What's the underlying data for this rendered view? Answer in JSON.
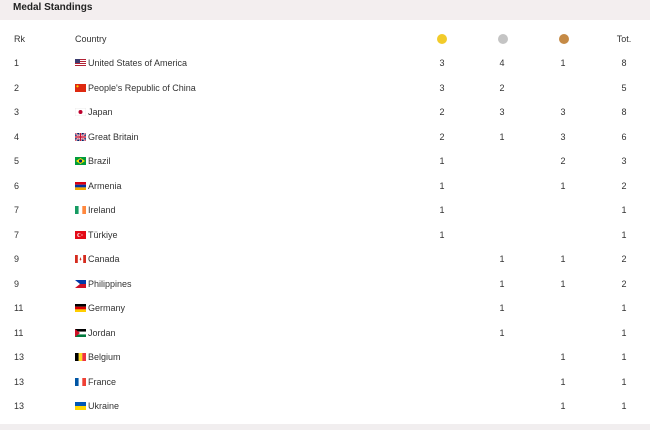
{
  "title": "Medal Standings",
  "headers": {
    "rank": "Rk",
    "country": "Country",
    "total": "Tot."
  },
  "medal_colors": {
    "gold": "#f2cb2a",
    "silver": "#c4c4c4",
    "bronze": "#c58a45"
  },
  "rows": [
    {
      "rank": "1",
      "country": "United States of America",
      "flag": "us-flag-icon",
      "gold": "3",
      "silver": "4",
      "bronze": "1",
      "total": "8"
    },
    {
      "rank": "2",
      "country": "People's Republic of China",
      "flag": "china-flag-icon",
      "gold": "3",
      "silver": "2",
      "bronze": "",
      "total": "5"
    },
    {
      "rank": "3",
      "country": "Japan",
      "flag": "japan-flag-icon",
      "gold": "2",
      "silver": "3",
      "bronze": "3",
      "total": "8"
    },
    {
      "rank": "4",
      "country": "Great Britain",
      "flag": "uk-flag-icon",
      "gold": "2",
      "silver": "1",
      "bronze": "3",
      "total": "6"
    },
    {
      "rank": "5",
      "country": "Brazil",
      "flag": "brazil-flag-icon",
      "gold": "1",
      "silver": "",
      "bronze": "2",
      "total": "3"
    },
    {
      "rank": "6",
      "country": "Armenia",
      "flag": "armenia-flag-icon",
      "gold": "1",
      "silver": "",
      "bronze": "1",
      "total": "2"
    },
    {
      "rank": "7",
      "country": "Ireland",
      "flag": "ireland-flag-icon",
      "gold": "1",
      "silver": "",
      "bronze": "",
      "total": "1"
    },
    {
      "rank": "7",
      "country": "Türkiye",
      "flag": "turkiye-flag-icon",
      "gold": "1",
      "silver": "",
      "bronze": "",
      "total": "1"
    },
    {
      "rank": "9",
      "country": "Canada",
      "flag": "canada-flag-icon",
      "gold": "",
      "silver": "1",
      "bronze": "1",
      "total": "2"
    },
    {
      "rank": "9",
      "country": "Philippines",
      "flag": "philippines-flag-icon",
      "gold": "",
      "silver": "1",
      "bronze": "1",
      "total": "2"
    },
    {
      "rank": "11",
      "country": "Germany",
      "flag": "germany-flag-icon",
      "gold": "",
      "silver": "1",
      "bronze": "",
      "total": "1"
    },
    {
      "rank": "11",
      "country": "Jordan",
      "flag": "jordan-flag-icon",
      "gold": "",
      "silver": "1",
      "bronze": "",
      "total": "1"
    },
    {
      "rank": "13",
      "country": "Belgium",
      "flag": "belgium-flag-icon",
      "gold": "",
      "silver": "",
      "bronze": "1",
      "total": "1"
    },
    {
      "rank": "13",
      "country": "France",
      "flag": "france-flag-icon",
      "gold": "",
      "silver": "",
      "bronze": "1",
      "total": "1"
    },
    {
      "rank": "13",
      "country": "Ukraine",
      "flag": "ukraine-flag-icon",
      "gold": "",
      "silver": "",
      "bronze": "1",
      "total": "1"
    }
  ]
}
